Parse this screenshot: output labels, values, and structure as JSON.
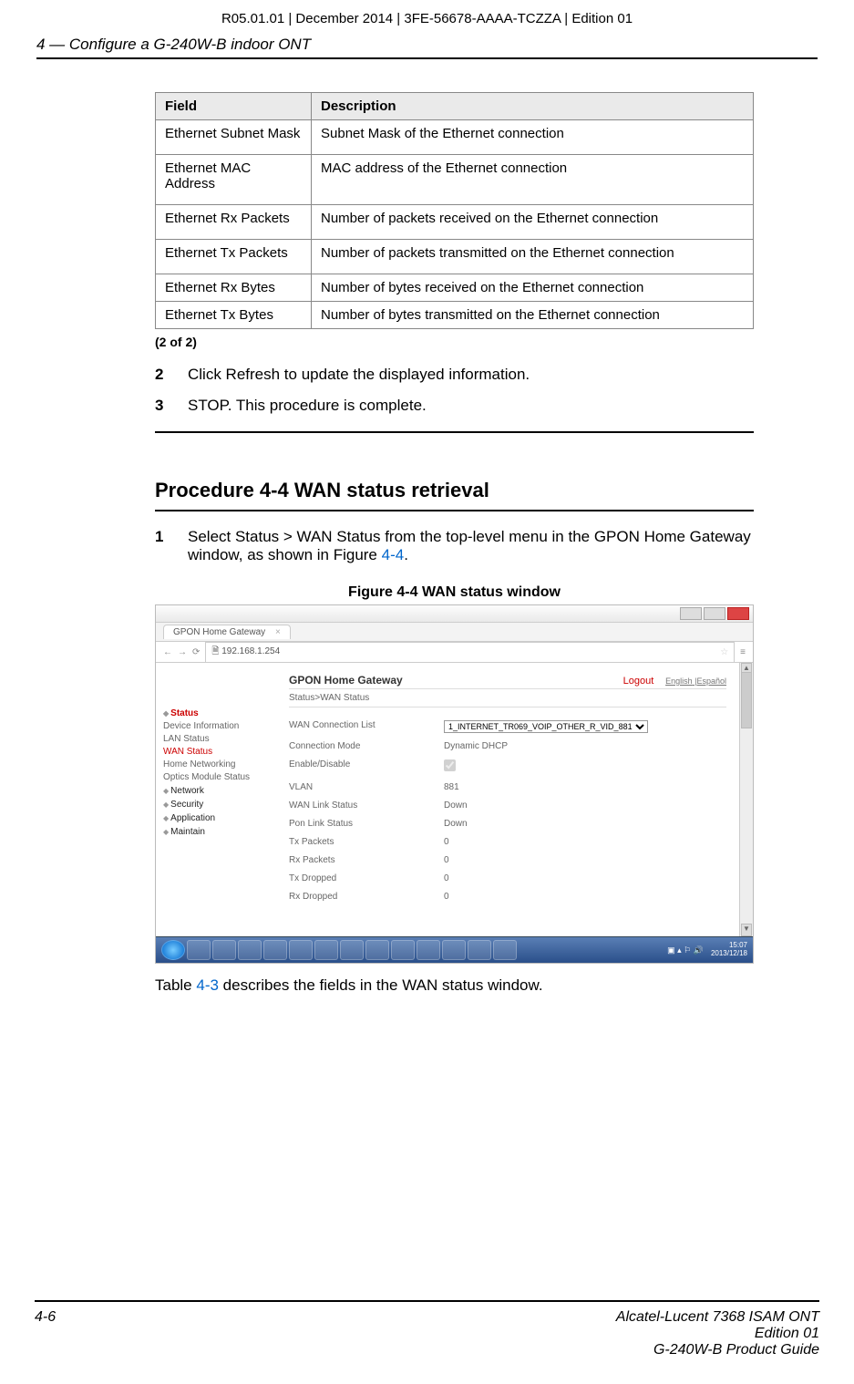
{
  "doc_meta": "R05.01.01 | December 2014 | 3FE-56678-AAAA-TCZZA | Edition 01",
  "section_title": "4 —  Configure a G-240W-B indoor ONT",
  "table": {
    "headers": [
      "Field",
      "Description"
    ],
    "rows": [
      {
        "field": "Ethernet Subnet Mask",
        "desc": "Subnet Mask of the Ethernet connection"
      },
      {
        "field": "Ethernet MAC Address",
        "desc": "MAC address of the Ethernet connection"
      },
      {
        "field": "Ethernet Rx Packets",
        "desc": "Number of packets received on the Ethernet connection"
      },
      {
        "field": "Ethernet Tx Packets",
        "desc": "Number of packets transmitted on the Ethernet connection"
      },
      {
        "field": "Ethernet Rx Bytes",
        "desc": "Number of bytes received on the Ethernet connection"
      },
      {
        "field": "Ethernet Tx Bytes",
        "desc": "Number of bytes transmitted on the Ethernet connection"
      }
    ],
    "footer_text": "(2 of 2)"
  },
  "steps_a": [
    {
      "num": "2",
      "text": "Click Refresh to update the displayed information."
    },
    {
      "num": "3",
      "text": "STOP. This procedure is complete."
    }
  ],
  "procedure_heading": "Procedure 4-4  WAN status retrieval",
  "step_b_num": "1",
  "step_b_text_pre": "Select Status > WAN Status from the top-level menu in the GPON Home Gateway window, as shown in Figure ",
  "step_b_link": "4-4",
  "step_b_text_post": ".",
  "figure_caption": "Figure 4-4  WAN status window",
  "figure": {
    "tab_title": "GPON Home Gateway",
    "url": "192.168.1.254",
    "brand": "GPON Home Gateway",
    "logout": "Logout",
    "lang1": "English",
    "lang2": "Español",
    "crumb": "Status>WAN Status",
    "sidebar": {
      "status": "Status",
      "items": [
        "Device Information",
        "LAN Status",
        "WAN Status",
        "Home Networking",
        "Optics Module Status"
      ],
      "groups": [
        "Network",
        "Security",
        "Application",
        "Maintain"
      ]
    },
    "rows": [
      {
        "lbl": "WAN Connection List",
        "val_select": "1_INTERNET_TR069_VOIP_OTHER_R_VID_881"
      },
      {
        "lbl": "Connection Mode",
        "val": "Dynamic DHCP"
      },
      {
        "lbl": "Enable/Disable",
        "val_checkbox": true
      },
      {
        "lbl": "VLAN",
        "val": "881"
      },
      {
        "lbl": "WAN Link Status",
        "val": "Down"
      },
      {
        "lbl": "Pon Link Status",
        "val": "Down"
      },
      {
        "lbl": "Tx Packets",
        "val": "0"
      },
      {
        "lbl": "Rx Packets",
        "val": "0"
      },
      {
        "lbl": "Tx Dropped",
        "val": "0"
      },
      {
        "lbl": "Rx Dropped",
        "val": "0"
      }
    ],
    "clock_time": "15:07",
    "clock_date": "2013/12/18"
  },
  "post_fig_pre": "Table ",
  "post_fig_link": "4-3",
  "post_fig_post": " describes the fields in the WAN status window.",
  "footer": {
    "page_num": "4-6",
    "line1": "Alcatel-Lucent 7368 ISAM ONT",
    "line2": "Edition 01",
    "line3": "G-240W-B Product Guide"
  }
}
